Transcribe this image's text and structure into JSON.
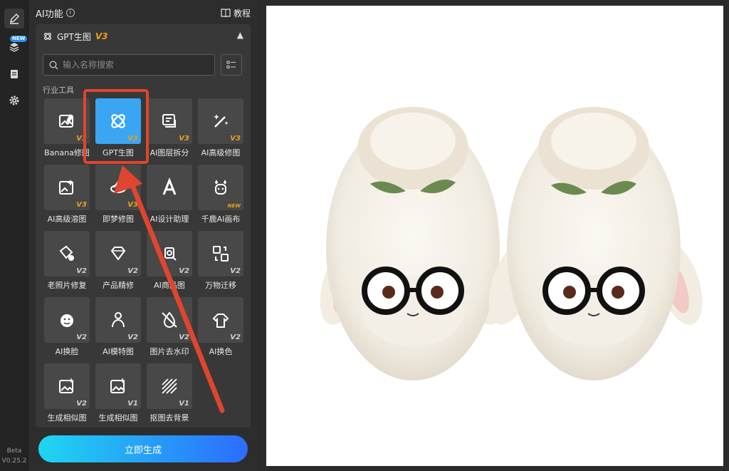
{
  "panel": {
    "title": "AI功能",
    "info_icon": "info-icon",
    "tutorial_label": "教程"
  },
  "section": {
    "title": "GPT生图",
    "version": "V3"
  },
  "search": {
    "placeholder": "输入名称搜索"
  },
  "group_label": "行业工具",
  "tools": [
    {
      "label": "Banana修图",
      "version": "V3",
      "icon": "image-edit-icon"
    },
    {
      "label": "GPT生图",
      "version": "V3",
      "icon": "gpt-logo-icon",
      "selected": true
    },
    {
      "label": "AI图层拆分",
      "version": "V3",
      "icon": "layer-split-icon"
    },
    {
      "label": "AI高级修图",
      "version": "V3",
      "icon": "magic-wand-icon"
    },
    {
      "label": "AI高级溶图",
      "version": "V3",
      "icon": "image-sparkle-icon"
    },
    {
      "label": "即梦修图",
      "version": "V3",
      "icon": "dream-icon"
    },
    {
      "label": "AI设计助理",
      "version": "",
      "icon": "design-assistant-icon"
    },
    {
      "label": "千鹿AI画布",
      "version": "NEW",
      "icon": "deer-icon"
    },
    {
      "label": "老照片修复",
      "version": "V2",
      "icon": "photo-repair-icon"
    },
    {
      "label": "产品精修",
      "version": "V2",
      "icon": "diamond-icon"
    },
    {
      "label": "AI商品图",
      "version": "V2",
      "icon": "product-image-icon"
    },
    {
      "label": "万物迁移",
      "version": "V2",
      "icon": "transfer-icon"
    },
    {
      "label": "AI换脸",
      "version": "V2",
      "icon": "face-swap-icon"
    },
    {
      "label": "AI模特图",
      "version": "V2",
      "icon": "model-icon"
    },
    {
      "label": "图片去水印",
      "version": "V2",
      "icon": "watermark-remove-icon"
    },
    {
      "label": "AI换色",
      "version": "V2",
      "icon": "color-change-icon"
    },
    {
      "label": "生成相似图",
      "version": "V2",
      "icon": "similar-image-icon"
    },
    {
      "label": "生成相似图",
      "version": "V1",
      "icon": "similar-image-icon"
    },
    {
      "label": "抠图去背景",
      "version": "V1",
      "icon": "remove-background-icon"
    }
  ],
  "generate_label": "立即生成",
  "version_info": {
    "stage": "Beta",
    "number": "V0.25.2"
  },
  "colors": {
    "accent": "#3aa5f2",
    "highlight": "#e0452f",
    "version_gold": "#e6a21a"
  }
}
